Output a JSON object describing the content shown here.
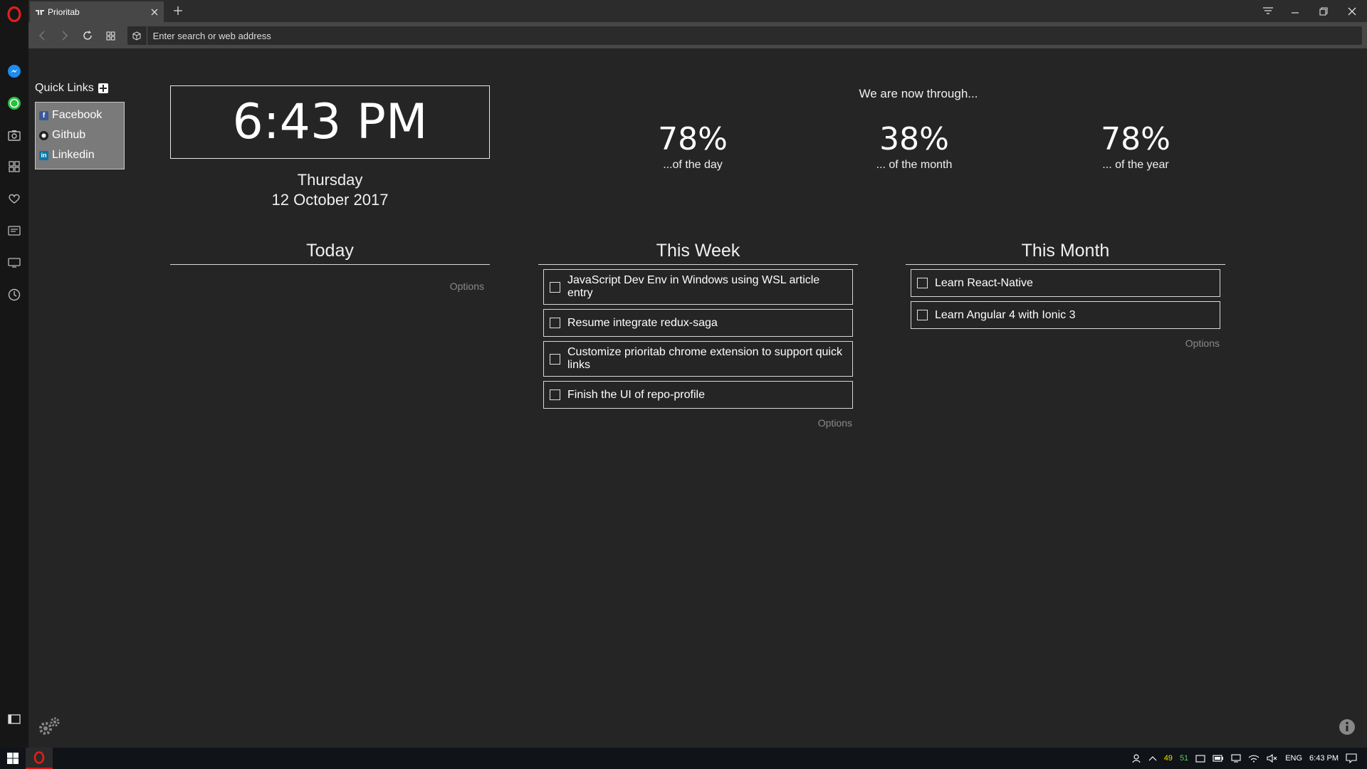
{
  "browser": {
    "tab_title": "Prioritab",
    "address_placeholder": "Enter search or web address"
  },
  "sidebar": {
    "icons": [
      "opera-logo",
      "messenger-icon",
      "whatsapp-icon",
      "camera-icon",
      "speed-dial-icon",
      "heart-icon",
      "news-icon",
      "tabs-icon",
      "history-icon",
      "sidebar-toggle-icon"
    ]
  },
  "quick_links": {
    "title": "Quick Links",
    "items": [
      {
        "label": "Facebook",
        "icon": "facebook-icon"
      },
      {
        "label": "Github",
        "icon": "github-icon"
      },
      {
        "label": "Linkedin",
        "icon": "linkedin-icon"
      }
    ]
  },
  "clock": {
    "time": "6:43 PM",
    "day": "Thursday",
    "date": "12 October 2017"
  },
  "progress": {
    "heading": "We are now through...",
    "day": {
      "value": "78%",
      "label": "...of the day"
    },
    "month": {
      "value": "38%",
      "label": "... of the month"
    },
    "year": {
      "value": "78%",
      "label": "... of the year"
    }
  },
  "columns": {
    "today": {
      "title": "Today",
      "options": "Options",
      "tasks": []
    },
    "week": {
      "title": "This Week",
      "options": "Options",
      "tasks": [
        "JavaScript Dev Env in Windows using WSL article entry",
        "Resume integrate redux-saga",
        "Customize prioritab chrome extension to support quick links",
        "Finish the UI of repo-profile"
      ]
    },
    "month": {
      "title": "This Month",
      "options": "Options",
      "tasks": [
        "Learn React-Native",
        "Learn Angular 4 with Ionic 3"
      ]
    }
  },
  "taskbar": {
    "tray_num1": "49",
    "tray_num2": "51",
    "language": "ENG",
    "time": "6:43 PM"
  },
  "colors": {
    "background": "#252525",
    "sidebar": "#161616",
    "opera_red": "#e0201b"
  }
}
